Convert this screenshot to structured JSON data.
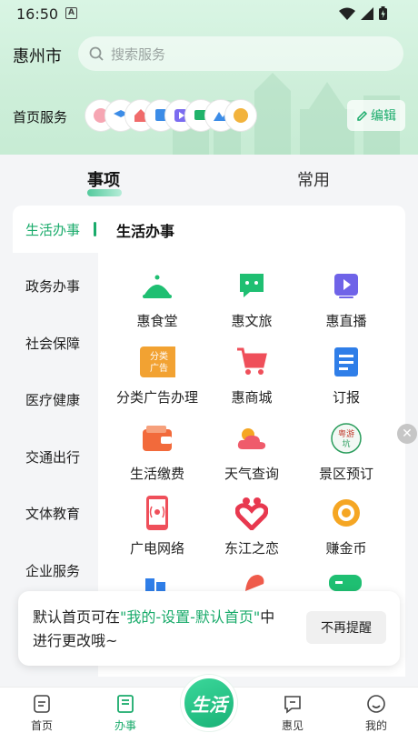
{
  "status": {
    "time": "16:50",
    "badge": "A"
  },
  "header": {
    "city": "惠州市",
    "search_placeholder": "搜索服务",
    "home_services_label": "首页服务",
    "edit_label": "编辑"
  },
  "tabs": [
    {
      "label": "事项",
      "active": true
    },
    {
      "label": "常用",
      "active": false
    }
  ],
  "sidebar": {
    "items": [
      {
        "label": "生活办事",
        "active": true
      },
      {
        "label": "政务办事"
      },
      {
        "label": "社会保障"
      },
      {
        "label": "医疗健康"
      },
      {
        "label": "交通出行"
      },
      {
        "label": "文体教育"
      },
      {
        "label": "企业服务"
      }
    ]
  },
  "section_title": "生活办事",
  "services": [
    {
      "label": "惠食堂",
      "icon": "food-cloche-icon"
    },
    {
      "label": "惠文旅",
      "icon": "chat-bubble-icon"
    },
    {
      "label": "惠直播",
      "icon": "play-icon"
    },
    {
      "label": "分类广告办理",
      "icon": "classified-ads-icon",
      "icon_text": "分类\n广告"
    },
    {
      "label": "惠商城",
      "icon": "shopping-cart-icon"
    },
    {
      "label": "订报",
      "icon": "newspaper-icon"
    },
    {
      "label": "生活缴费",
      "icon": "wallet-icon"
    },
    {
      "label": "天气查询",
      "icon": "weather-icon"
    },
    {
      "label": "景区预订",
      "icon": "scenic-booking-icon",
      "icon_text": "粤游坑"
    },
    {
      "label": "广电网络",
      "icon": "phone-broadcast-icon"
    },
    {
      "label": "东江之恋",
      "icon": "heart-people-icon"
    },
    {
      "label": "赚金币",
      "icon": "coin-icon"
    }
  ],
  "toast": {
    "text_before": "默认首页可在",
    "text_highlight": "\"我的-设置-默认首页\"",
    "text_after": "中进行更改哦~",
    "button": "不再提醒"
  },
  "bottom_nav": [
    {
      "label": "首页",
      "icon": "home-icon"
    },
    {
      "label": "办事",
      "icon": "book-icon",
      "active": true
    },
    {
      "label": "生活",
      "icon": "life-center-icon"
    },
    {
      "label": "惠见",
      "icon": "comment-icon"
    },
    {
      "label": "我的",
      "icon": "smile-icon"
    }
  ],
  "colors": {
    "accent": "#1aab6b",
    "header_bg": "#cdeed9",
    "toast_btn_bg": "#f0f0f0"
  }
}
